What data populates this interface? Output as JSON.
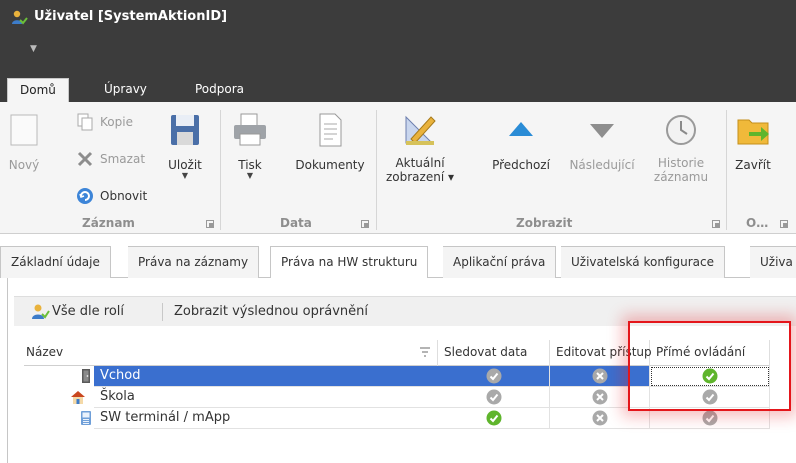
{
  "window": {
    "title": "Uživatel [SystemAktionID]"
  },
  "ribbon_tabs": [
    {
      "label": "Domů",
      "active": true
    },
    {
      "label": "Úpravy",
      "active": false
    },
    {
      "label": "Podpora",
      "active": false
    }
  ],
  "ribbon": {
    "zaznam": {
      "group_label": "Záznam",
      "novy": "Nový",
      "kopie": "Kopie",
      "smazat": "Smazat",
      "obnovit": "Obnovit",
      "ulozit": "Uložit"
    },
    "data": {
      "group_label": "Data",
      "tisk": "Tisk",
      "dokumenty": "Dokumenty"
    },
    "zobrazit": {
      "group_label": "Zobrazit",
      "aktualni_1": "Aktuální",
      "aktualni_2": "zobrazení ▾",
      "predchozi": "Předchozí",
      "nasledujici": "Následující",
      "historie_1": "Historie",
      "historie_2": "záznamu"
    },
    "last": {
      "group_label": "O…",
      "zavrit": "Zavřít"
    }
  },
  "doc_tabs": [
    {
      "label": "Základní údaje",
      "active": false
    },
    {
      "label": "Práva na záznamy",
      "active": false
    },
    {
      "label": "Práva na HW strukturu",
      "active": true
    },
    {
      "label": "Aplikační práva",
      "active": false
    },
    {
      "label": "Uživatelská konfigurace",
      "active": false
    },
    {
      "label": "Uživa",
      "active": false
    }
  ],
  "toolbar": {
    "role_button": "Vše dle rolí",
    "effective_button": "Zobrazit výslednou oprávnění"
  },
  "grid": {
    "columns": [
      "Název",
      "Sledovat data",
      "Editovat přístup",
      "Přímé ovládání"
    ],
    "rows": [
      {
        "name": "Vchod",
        "icon": "door-icon",
        "selected": true,
        "sledovat": "gray-check",
        "editovat": "gray-cross",
        "prime": "green-check"
      },
      {
        "name": "Škola",
        "icon": "house-icon",
        "selected": false,
        "sledovat": "gray-check",
        "editovat": "gray-cross",
        "prime": "gray-check"
      },
      {
        "name": "SW terminál / mApp",
        "icon": "terminal-icon",
        "selected": false,
        "sledovat": "green-check",
        "editovat": "gray-cross",
        "prime": "gray-check"
      }
    ]
  },
  "colors": {
    "titlebar": "#3c3c3c",
    "selection": "#3a6fcf",
    "highlight": "#e4161b",
    "status_green": "#5fb52c",
    "status_gray": "#a9a9a9"
  }
}
